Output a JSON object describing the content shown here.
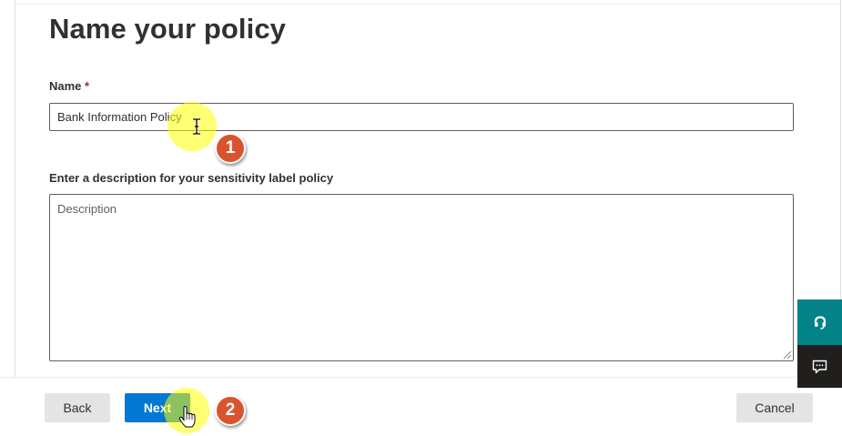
{
  "page": {
    "title": "Name your policy"
  },
  "form": {
    "name_label": "Name",
    "required_marker": "*",
    "name_value": "Bank Information Policy",
    "description_label": "Enter a description for your sensitivity label policy",
    "description_placeholder": "Description"
  },
  "footer": {
    "back_label": "Back",
    "next_label": "Next",
    "cancel_label": "Cancel"
  },
  "annotations": {
    "step_1": "1",
    "step_2": "2"
  },
  "side_panel": {
    "help_icon": "headset-icon",
    "feedback_icon": "feedback-icon"
  },
  "colors": {
    "primary": "#0078d4",
    "step_badge": "#d9542e",
    "help_bg": "#038387",
    "feedback_bg": "#201f1e",
    "highlight": "#ffff00"
  }
}
